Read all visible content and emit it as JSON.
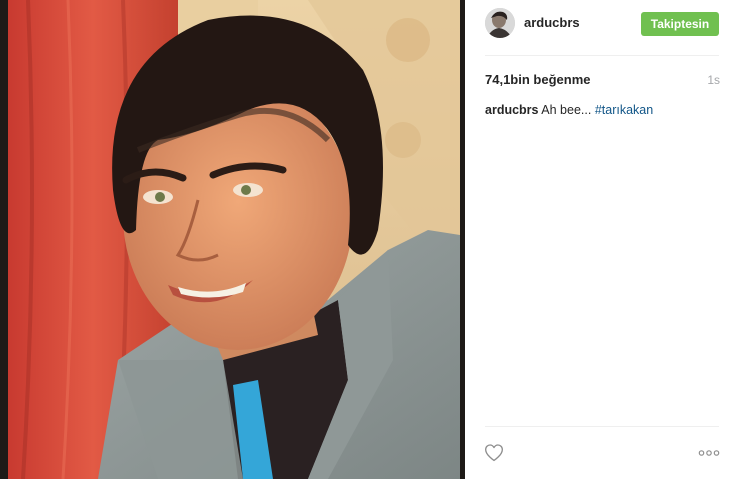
{
  "post": {
    "username": "arducbrs",
    "follow_label": "Takiptesin",
    "likes": "74,1bin beğenme",
    "time": "1s",
    "caption": {
      "username": "arducbrs",
      "text": "Ah bee...",
      "hashtag": "#tarıkakan"
    }
  },
  "colors": {
    "follow_button": "#70c050",
    "hashtag": "#125688",
    "text": "#262626",
    "muted": "#a5a7aa"
  },
  "icons": {
    "like": "heart-icon",
    "options": "more-options-icon"
  }
}
